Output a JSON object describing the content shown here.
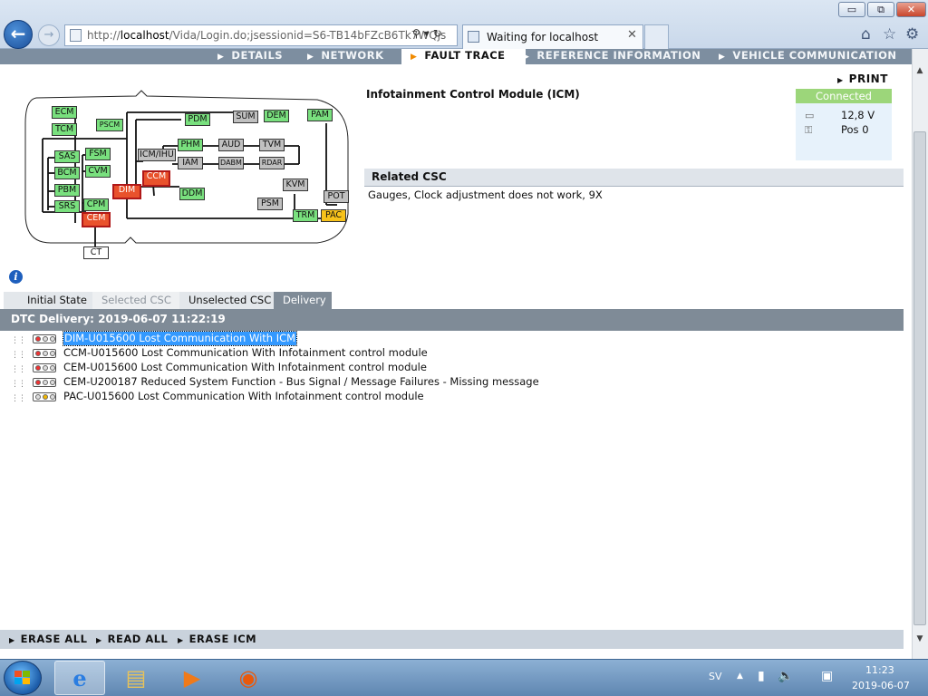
{
  "browser": {
    "url_prefix": "http://",
    "url_host": "localhost",
    "url_rest": "/Vida/Login.do;jsessionid=S6-TB14bFZcB6Tk7WQjs",
    "tab_title": "Waiting for localhost",
    "window_buttons": {
      "minimize": "▭",
      "maximize": "⧉",
      "close": "✕"
    }
  },
  "nav": {
    "tabs": [
      {
        "label": "DETAILS",
        "active": false
      },
      {
        "label": "NETWORK",
        "active": false
      },
      {
        "label": "FAULT TRACE",
        "active": true
      },
      {
        "label": "REFERENCE INFORMATION",
        "active": false
      },
      {
        "label": "VEHICLE COMMUNICATION",
        "active": false
      }
    ],
    "arrow": "▶"
  },
  "print_label": "PRINT",
  "module": {
    "title": "Infotainment Control Module (ICM)"
  },
  "status": {
    "header": "Connected",
    "voltage": "12,8 V",
    "position": "Pos 0",
    "battery_icon": "▭",
    "key_icon": "⚿"
  },
  "related": {
    "header": "Related CSC",
    "text": "Gauges, Clock adjustment does not work, 9X"
  },
  "diagram": {
    "nodes": [
      {
        "id": "ECM",
        "label": "ECM",
        "state": "g"
      },
      {
        "id": "TCM",
        "label": "TCM",
        "state": "g"
      },
      {
        "id": "PSCM",
        "label": "PSCM",
        "state": "g"
      },
      {
        "id": "PDM",
        "label": "PDM",
        "state": "g"
      },
      {
        "id": "SUM",
        "label": "SUM",
        "state": "gr"
      },
      {
        "id": "DEM",
        "label": "DEM",
        "state": "g"
      },
      {
        "id": "PAM",
        "label": "PAM",
        "state": "g"
      },
      {
        "id": "SAS",
        "label": "SAS",
        "state": "g"
      },
      {
        "id": "FSM",
        "label": "FSM",
        "state": "g"
      },
      {
        "id": "ICMIHU",
        "label": "ICM/IHU",
        "state": "gr"
      },
      {
        "id": "PHM",
        "label": "PHM",
        "state": "g"
      },
      {
        "id": "AUD",
        "label": "AUD",
        "state": "gr"
      },
      {
        "id": "TVM",
        "label": "TVM",
        "state": "gr"
      },
      {
        "id": "BCM",
        "label": "BCM",
        "state": "g"
      },
      {
        "id": "CVM",
        "label": "CVM",
        "state": "g"
      },
      {
        "id": "IAM",
        "label": "IAM",
        "state": "gr"
      },
      {
        "id": "DABM",
        "label": "DABM",
        "state": "gr"
      },
      {
        "id": "RDAR",
        "label": "RDAR",
        "state": "gr"
      },
      {
        "id": "CCM",
        "label": "CCM",
        "state": "r"
      },
      {
        "id": "PBM",
        "label": "PBM",
        "state": "g"
      },
      {
        "id": "DIM",
        "label": "DIM",
        "state": "r"
      },
      {
        "id": "DDM",
        "label": "DDM",
        "state": "g"
      },
      {
        "id": "KVM",
        "label": "KVM",
        "state": "gr"
      },
      {
        "id": "POT",
        "label": "POT",
        "state": "gr"
      },
      {
        "id": "SRS",
        "label": "SRS",
        "state": "g"
      },
      {
        "id": "CPM",
        "label": "CPM",
        "state": "g"
      },
      {
        "id": "PSM",
        "label": "PSM",
        "state": "gr"
      },
      {
        "id": "TRM",
        "label": "TRM",
        "state": "g"
      },
      {
        "id": "PAC",
        "label": "PAC",
        "state": "y"
      },
      {
        "id": "CEM",
        "label": "CEM",
        "state": "r"
      },
      {
        "id": "CT",
        "label": "CT",
        "state": "w"
      }
    ],
    "colors": {
      "g": "#79e07e",
      "gr": "#c0c0c0",
      "r": "#e9522c",
      "y": "#f7c21a"
    }
  },
  "subtabs": [
    {
      "label": "Initial State",
      "state": "normal"
    },
    {
      "label": "Selected CSC",
      "state": "disabled"
    },
    {
      "label": "Unselected CSC",
      "state": "normal"
    },
    {
      "label": "Delivery",
      "state": "active"
    }
  ],
  "dtc": {
    "header": "DTC Delivery: 2019-06-07 11:22:19",
    "rows": [
      {
        "text": "DIM-U015600 Lost Communication With ICM",
        "light": "red",
        "selected": true
      },
      {
        "text": "CCM-U015600 Lost Communication With Infotainment control module",
        "light": "red",
        "selected": false
      },
      {
        "text": "CEM-U015600 Lost Communication With Infotainment control module",
        "light": "red",
        "selected": false
      },
      {
        "text": "CEM-U200187 Reduced System Function - Bus Signal / Message Failures - Missing message",
        "light": "red",
        "selected": false
      },
      {
        "text": "PAC-U015600 Lost Communication With Infotainment control module",
        "light": "yellow",
        "selected": false
      }
    ]
  },
  "bottom_actions": [
    "ERASE ALL",
    "READ ALL",
    "ERASE ICM"
  ],
  "taskbar": {
    "language": "SV",
    "time": "11:23",
    "date": "2019-06-07"
  }
}
